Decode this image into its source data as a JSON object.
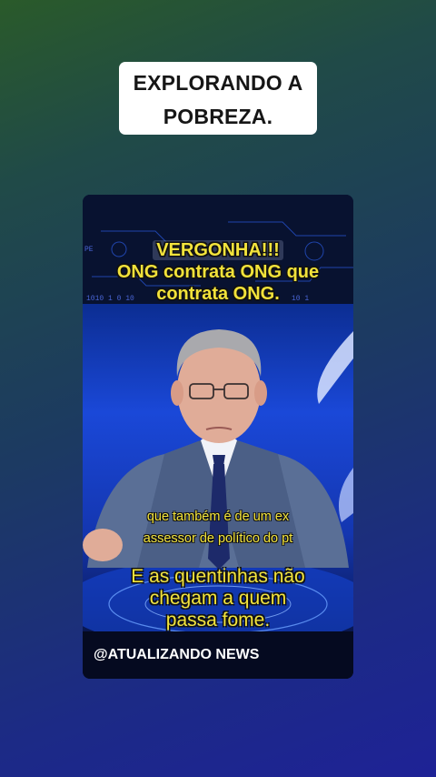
{
  "header": {
    "title_line1": "EXPLORANDO A",
    "title_line2": "POBREZA."
  },
  "video": {
    "banner_line1": "VERGONHA!!!",
    "banner_line2": "ONG contrata ONG que",
    "banner_line3": "contrata ONG.",
    "subtitle_line1": "que também é de um ex",
    "subtitle_line2": "assessor de político do pt",
    "caption_line1": "E as quentinhas não",
    "caption_line2": "chegam a quem",
    "caption_line3": "passa fome.",
    "watermark": "@ATUALIZANDO NEWS"
  },
  "colors": {
    "caption_yellow": "#f3e43c",
    "title_card_bg": "#ffffff"
  }
}
